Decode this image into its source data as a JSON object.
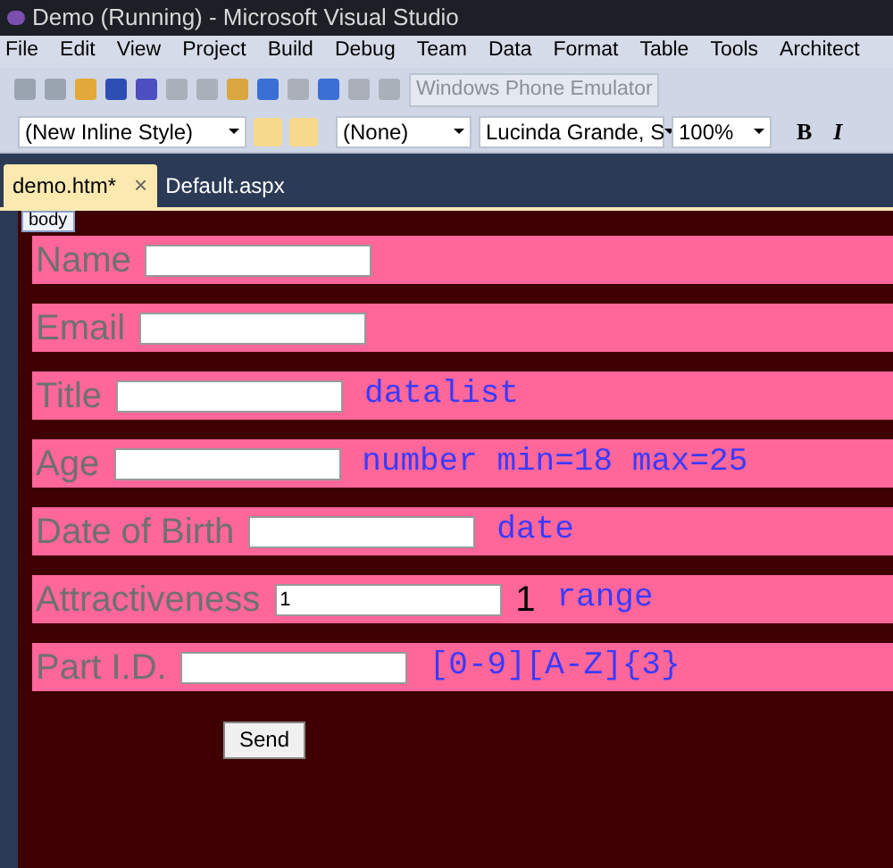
{
  "window": {
    "title": "Demo (Running) - Microsoft Visual Studio"
  },
  "menu": [
    "File",
    "Edit",
    "View",
    "Project",
    "Build",
    "Debug",
    "Team",
    "Data",
    "Format",
    "Table",
    "Tools",
    "Architect"
  ],
  "toolbar": {
    "target": "Windows Phone Emulator"
  },
  "format_bar": {
    "style": "(New Inline Style)",
    "block": "(None)",
    "font": "Lucinda Grande, S",
    "size": "100%",
    "bold": "B",
    "italic": "I"
  },
  "tabs": [
    {
      "label": "demo.htm*",
      "selected": true,
      "close": "×"
    },
    {
      "label": "Default.aspx",
      "selected": false
    }
  ],
  "tag_label": "body",
  "form": {
    "rows": [
      {
        "label": "Name"
      },
      {
        "label": "Email"
      },
      {
        "label": "Title",
        "note": "datalist"
      },
      {
        "label": "Age",
        "note": "number min=18 max=25"
      },
      {
        "label": "Date of Birth",
        "note": "date"
      },
      {
        "label": "Attractiveness",
        "value": "1",
        "output": "1",
        "note": "range"
      },
      {
        "label": "Part I.D.",
        "note": "[0-9][A-Z]{3}"
      }
    ],
    "submit": "Send"
  }
}
